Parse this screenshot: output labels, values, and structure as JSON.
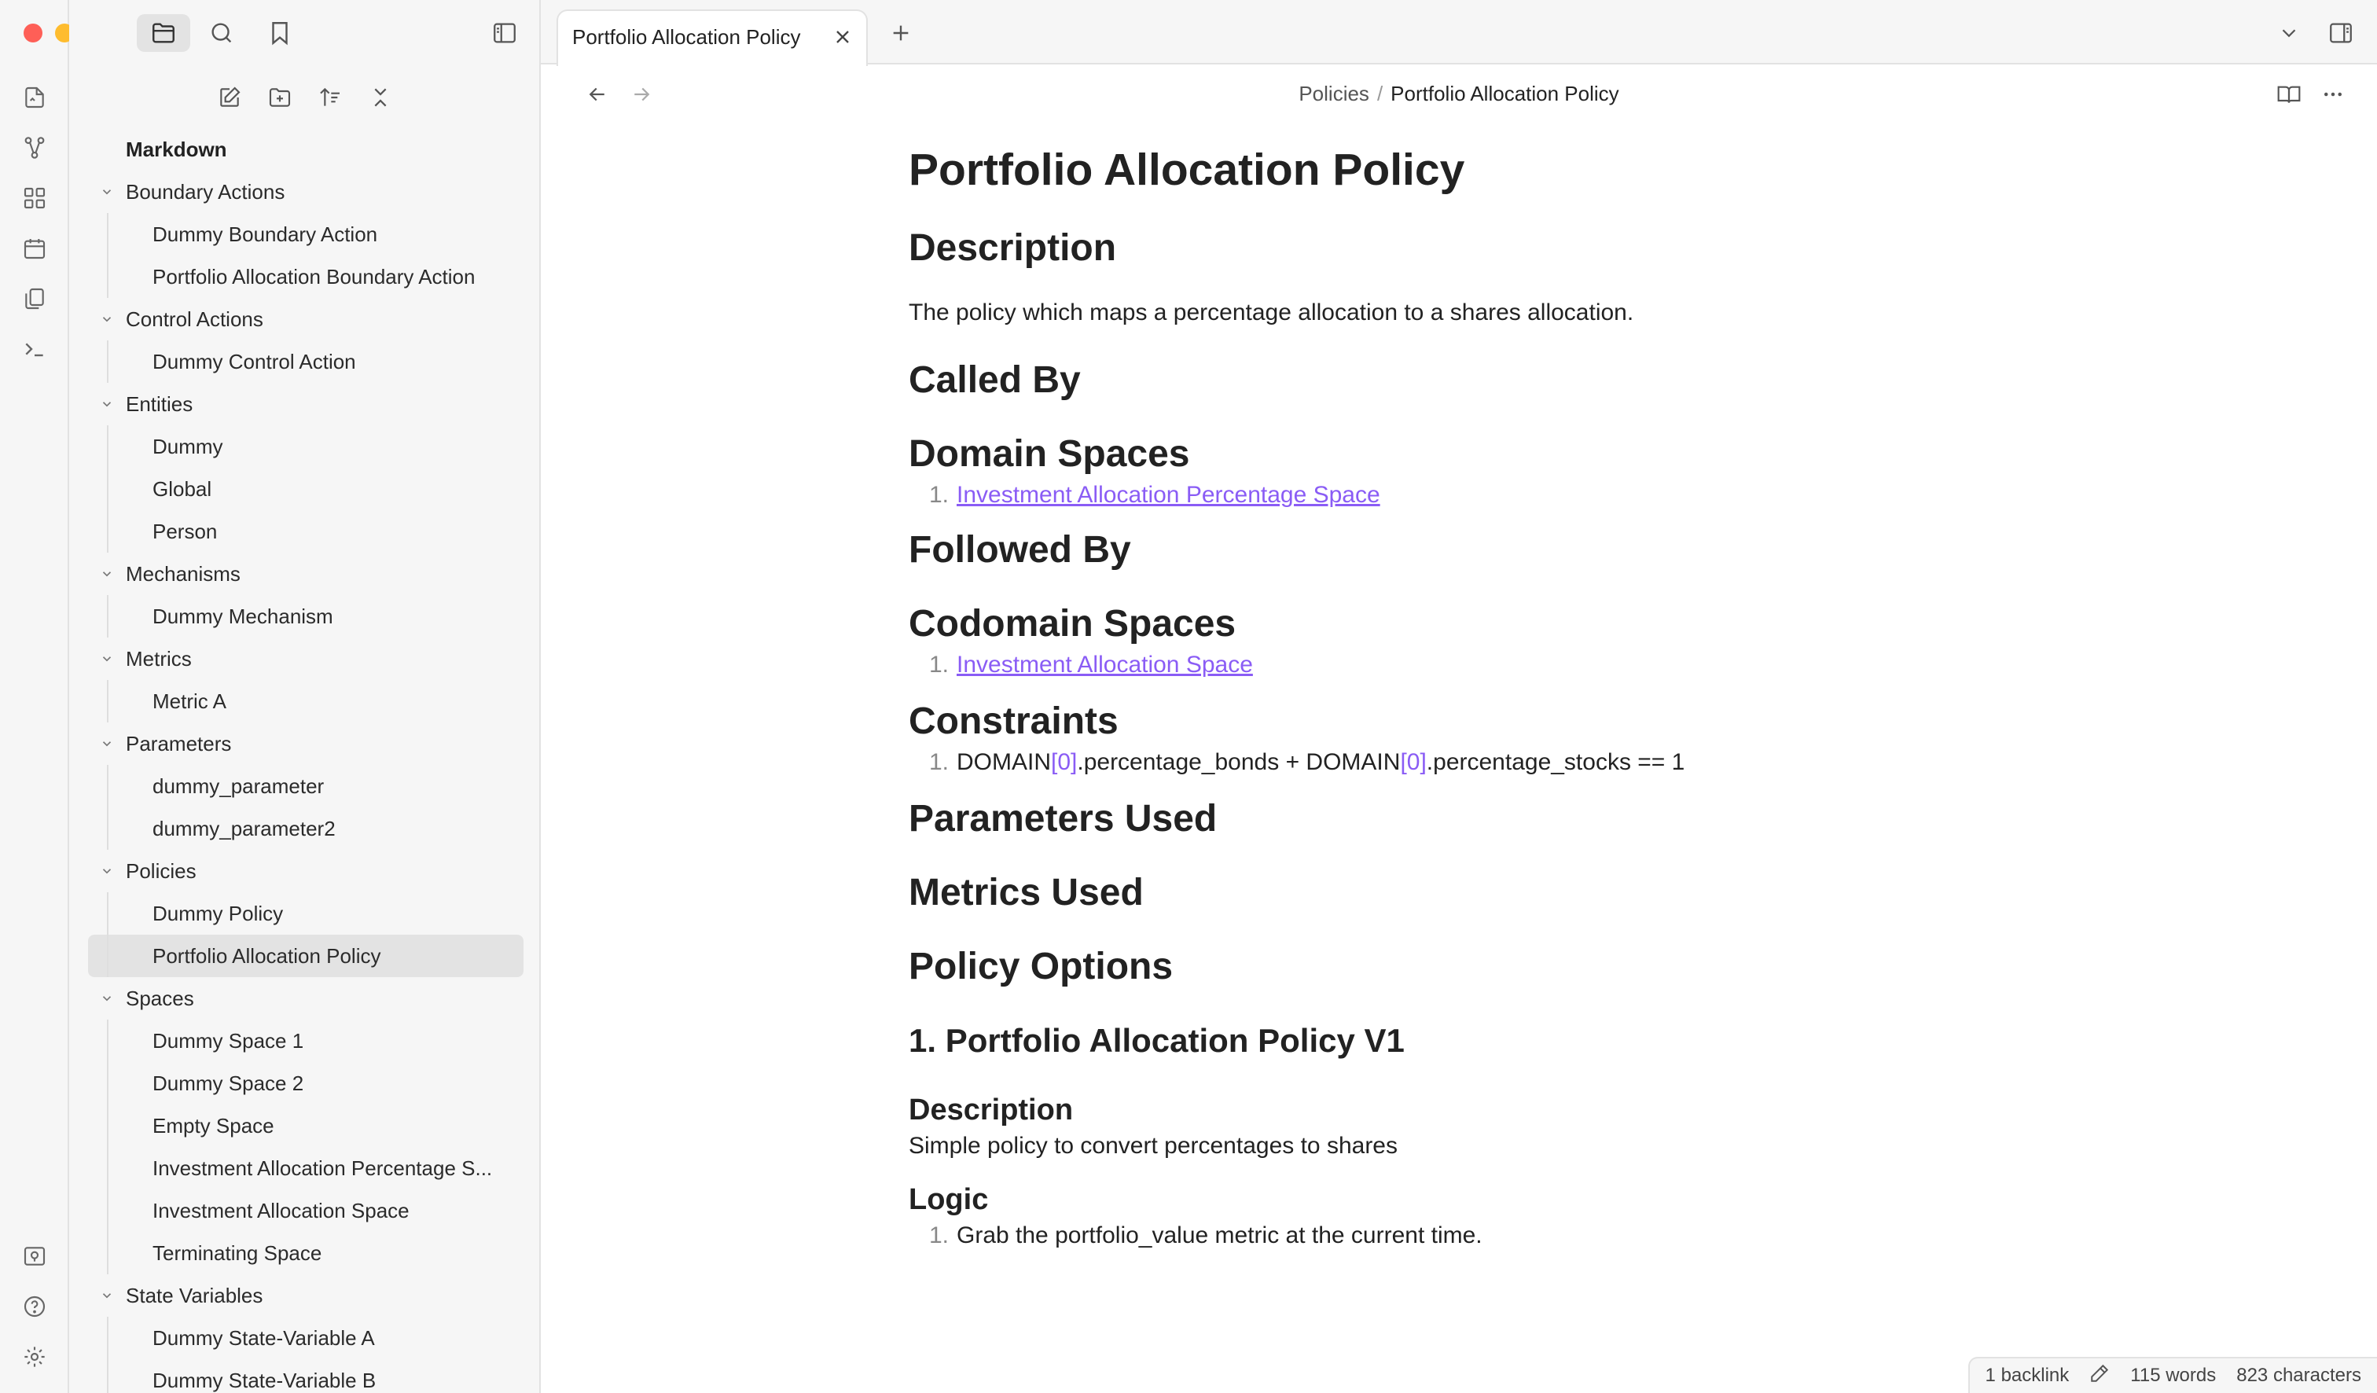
{
  "window": {
    "traffic_lights": {
      "close": "#fe5f57",
      "minimize": "#febc2e",
      "maximize": "#28c840"
    }
  },
  "ribbon": {
    "icons": [
      "quick-switch-icon",
      "graph-view-icon",
      "canvas-icon",
      "daily-note-icon",
      "templates-icon",
      "command-palette-icon"
    ],
    "bottom_icons": [
      "vault-switch-icon",
      "help-icon",
      "settings-icon"
    ]
  },
  "sidebar": {
    "top_icons": [
      "files-icon",
      "search-icon",
      "bookmark-icon"
    ],
    "toolbar_icons": [
      "new-note-icon",
      "new-folder-icon",
      "sort-icon",
      "collapse-all-icon"
    ],
    "root": "Markdown",
    "folders": [
      {
        "name": "Boundary Actions",
        "files": [
          "Dummy Boundary Action",
          "Portfolio Allocation Boundary Action"
        ]
      },
      {
        "name": "Control Actions",
        "files": [
          "Dummy Control Action"
        ]
      },
      {
        "name": "Entities",
        "files": [
          "Dummy",
          "Global",
          "Person"
        ]
      },
      {
        "name": "Mechanisms",
        "files": [
          "Dummy Mechanism"
        ]
      },
      {
        "name": "Metrics",
        "files": [
          "Metric A"
        ]
      },
      {
        "name": "Parameters",
        "files": [
          "dummy_parameter",
          "dummy_parameter2"
        ]
      },
      {
        "name": "Policies",
        "files": [
          "Dummy Policy",
          "Portfolio Allocation Policy"
        ]
      },
      {
        "name": "Spaces",
        "files": [
          "Dummy Space 1",
          "Dummy Space 2",
          "Empty Space",
          "Investment Allocation Percentage S...",
          "Investment Allocation Space",
          "Terminating Space"
        ]
      },
      {
        "name": "State Variables",
        "files": [
          "Dummy State-Variable A",
          "Dummy State-Variable B"
        ]
      }
    ],
    "active_file": "Portfolio Allocation Policy"
  },
  "tabs": {
    "active_title": "Portfolio Allocation Policy"
  },
  "breadcrumb": {
    "parent": "Policies",
    "separator": "/",
    "current": "Portfolio Allocation Policy"
  },
  "document": {
    "title": "Portfolio Allocation Policy",
    "h_description": "Description",
    "description": "The policy which maps a percentage allocation to a shares allocation.",
    "h_called_by": "Called By",
    "h_domain_spaces": "Domain Spaces",
    "domain_spaces": [
      "Investment Allocation Percentage Space"
    ],
    "h_followed_by": "Followed By",
    "h_codomain_spaces": "Codomain Spaces",
    "codomain_spaces": [
      "Investment Allocation Space"
    ],
    "h_constraints": "Constraints",
    "constraint_parts": {
      "a": "DOMAIN",
      "b": "[0]",
      "c": ".percentage_bonds + DOMAIN",
      "d": "[0]",
      "e": ".percentage_stocks == 1"
    },
    "h_parameters_used": "Parameters Used",
    "h_metrics_used": "Metrics Used",
    "h_policy_options": "Policy Options",
    "h_option_1": "1. Portfolio Allocation Policy V1",
    "h_option_description": "Description",
    "option_description": "Simple policy to convert percentages to shares",
    "h_logic": "Logic",
    "logic_steps": [
      "Grab the portfolio_value metric at the current time."
    ],
    "list_number": "1."
  },
  "statusbar": {
    "backlinks": "1 backlink",
    "words": "115 words",
    "characters": "823 characters"
  }
}
